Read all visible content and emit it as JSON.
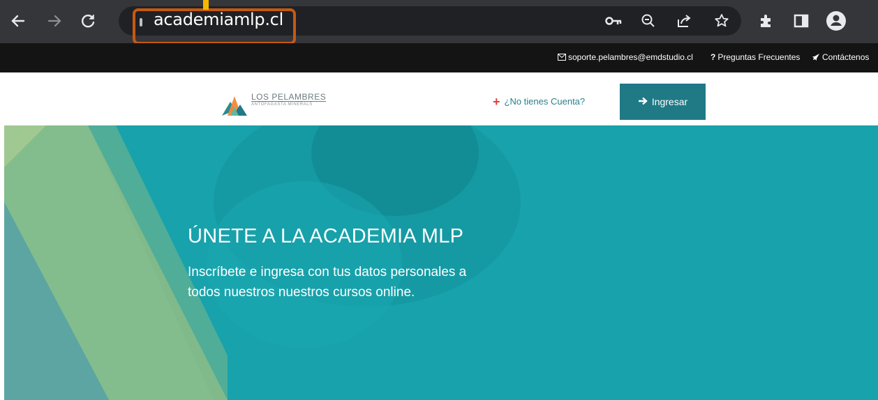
{
  "browser": {
    "url": "academiamlp.cl",
    "icons": [
      "back-arrow-icon",
      "forward-arrow-icon",
      "reload-icon",
      "key-icon",
      "zoom-out-icon",
      "share-icon",
      "star-icon",
      "extensions-icon",
      "side-panel-icon",
      "profile-icon"
    ]
  },
  "infobar": {
    "email": "soporte.pelambres@emdstudio.cl",
    "faq": "Preguntas Frecuentes",
    "contact": "Contáctenos"
  },
  "header": {
    "logo_title": "LOS PELAMBRES",
    "logo_subtitle": "ANTOFAGASTA MINERALS",
    "signup_label": "¿No tienes Cuenta?",
    "login_label": "Ingresar"
  },
  "hero": {
    "title": "ÚNETE A LA ACADEMIA MLP",
    "line1": "Inscríbete e ingresa con tus datos personales a",
    "line2": "todos nuestros nuestros cursos online."
  },
  "colors": {
    "toolbar": "#35363a",
    "omnibox": "#202124",
    "infobar": "#141414",
    "accent": "#1f7a86",
    "hero": "#18a2ab",
    "highlight": "#c55a11"
  }
}
